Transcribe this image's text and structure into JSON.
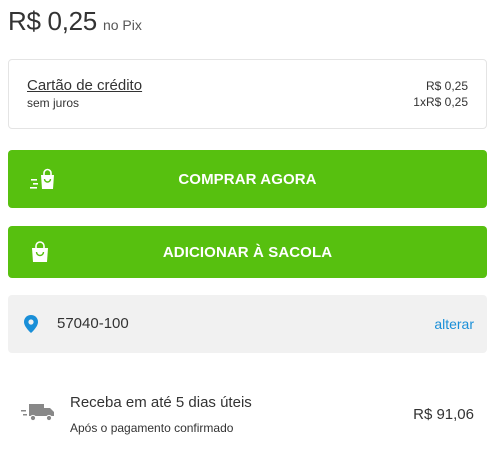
{
  "price": {
    "value": "R$ 0,25",
    "suffix": "no Pix"
  },
  "credit_card": {
    "title": "Cartão de crédito",
    "subtitle": "sem juros",
    "price": "R$ 0,25",
    "installments": "1xR$ 0,25"
  },
  "buttons": {
    "buy_now": "COMPRAR AGORA",
    "add_to_bag": "ADICIONAR À SACOLA",
    "color": "#57c00f"
  },
  "shipping_cep": {
    "value": "57040-100",
    "change_link": "alterar",
    "link_color": "#1a8fd8"
  },
  "delivery": {
    "title": "Receba em até 5 dias úteis",
    "subtitle": "Após o pagamento confirmado",
    "price": "R$ 91,06"
  },
  "icons": [
    "fast-bag-icon",
    "bag-icon",
    "location-pin-icon",
    "truck-icon"
  ]
}
